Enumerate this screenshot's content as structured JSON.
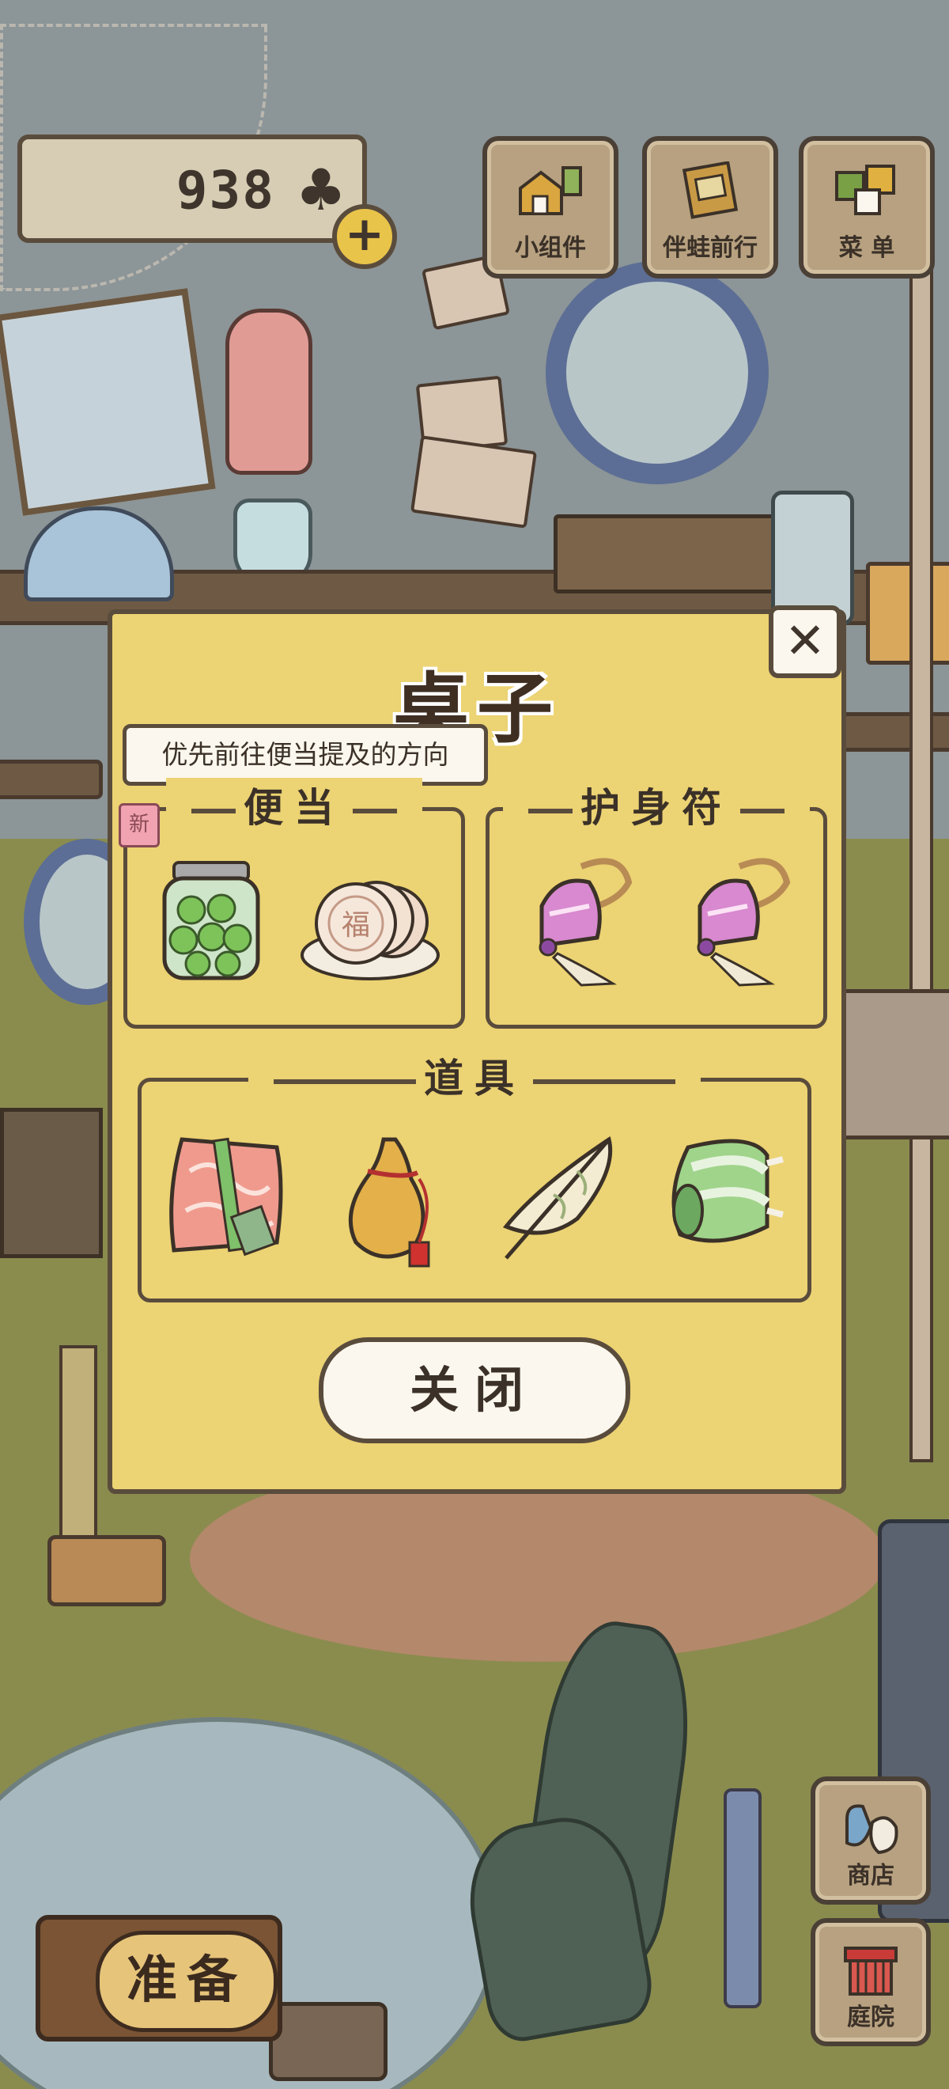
{
  "hud": {
    "clover_count": "938",
    "clover_icon": "clover-icon",
    "add_icon": "plus-icon",
    "buttons": [
      {
        "label": "小组件",
        "icon": "houses-icon"
      },
      {
        "label": "伴蛙前行",
        "icon": "album-icon"
      },
      {
        "label": "菜 单",
        "icon": "menu-boxes-icon"
      }
    ]
  },
  "dialog": {
    "title": "桌子",
    "tip": "优先前往便当提及的方向",
    "new_tag": "新",
    "groups": {
      "bento": {
        "title": "便当",
        "items": [
          "jar-of-green-grapes-icon",
          "lucky-rice-cakes-icon"
        ]
      },
      "charm": {
        "title": "护身符",
        "items": [
          "pink-bell-charm-icon",
          "pink-bell-charm-icon"
        ]
      },
      "tools": {
        "title": "道具",
        "items": [
          "red-blanket-icon",
          "gourd-icon",
          "paper-umbrella-icon",
          "green-sleeping-mat-icon"
        ]
      }
    },
    "close_label": "关闭",
    "close_x": "✕"
  },
  "bottom": {
    "ready_label": "准备",
    "shop_label": "商店",
    "garden_label": "庭院"
  },
  "colors": {
    "panel": "#ecd373",
    "border": "#5a4c3c",
    "hud_button": "#b7a180"
  }
}
